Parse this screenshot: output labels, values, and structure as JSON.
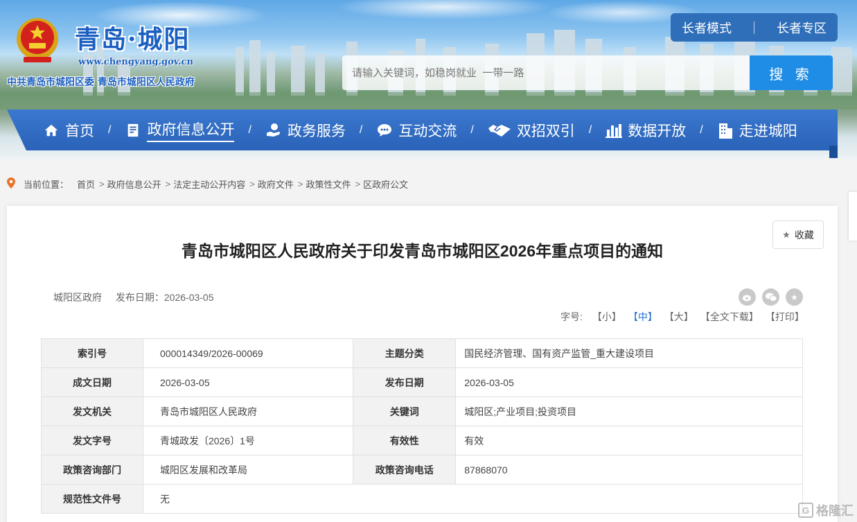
{
  "header": {
    "site_name": "青岛·城阳",
    "site_url": "www.chengyang.gov.cn",
    "site_org": "中共青岛市城阳区委  青岛市城阳区人民政府",
    "elder_mode": "长者模式",
    "elder_zone": "长者专区",
    "search_placeholder": "请输入关键词，如稳岗就业  一带一路",
    "search_button": "搜 索"
  },
  "nav": {
    "items": [
      {
        "label": "首页",
        "icon": "home-icon"
      },
      {
        "label": "政府信息公开",
        "icon": "document-icon"
      },
      {
        "label": "政务服务",
        "icon": "hand-service-icon"
      },
      {
        "label": "互动交流",
        "icon": "chat-icon"
      },
      {
        "label": "双招双引",
        "icon": "handshake-icon"
      },
      {
        "label": "数据开放",
        "icon": "bar-chart-icon"
      },
      {
        "label": "走进城阳",
        "icon": "building-icon"
      }
    ],
    "separator": "/"
  },
  "breadcrumb": {
    "prefix": "当前位置：",
    "items": [
      "首页",
      "政府信息公开",
      "法定主动公开内容",
      "政府文件",
      "政策性文件",
      "区政府公文"
    ],
    "arrow": ">"
  },
  "article": {
    "favorite": "收藏",
    "title": "青岛市城阳区人民政府关于印发青岛市城阳区2026年重点项目的通知",
    "source": "城阳区政府",
    "publish_label": "发布日期：2026-03-05",
    "font_size_label": "字号:",
    "font_small": "【小】",
    "font_medium": "【中】",
    "font_large": "【大】",
    "download": "【全文下载】",
    "print": "【打印】"
  },
  "info_table": {
    "rows": [
      {
        "k1": "索引号",
        "v1": "000014349/2026-00069",
        "k2": "主题分类",
        "v2": "国民经济管理、国有资产监管_重大建设项目"
      },
      {
        "k1": "成文日期",
        "v1": "2026-03-05",
        "k2": "发布日期",
        "v2": "2026-03-05"
      },
      {
        "k1": "发文机关",
        "v1": "青岛市城阳区人民政府",
        "k2": "关键词",
        "v2": "城阳区;产业项目;投资项目"
      },
      {
        "k1": "发文字号",
        "v1": "青城政发〔2026〕1号",
        "k2": "有效性",
        "v2": "有效"
      },
      {
        "k1": "政策咨询部门",
        "v1": "城阳区发展和改革局",
        "k2": "政策咨询电话",
        "v2": "87868070"
      },
      {
        "k1": "规范性文件号",
        "v1": "无"
      }
    ]
  },
  "watermark": "格隆汇",
  "colors": {
    "primary": "#2a63b8",
    "search": "#1f8de6",
    "brand_text": "#1b5fc1"
  }
}
